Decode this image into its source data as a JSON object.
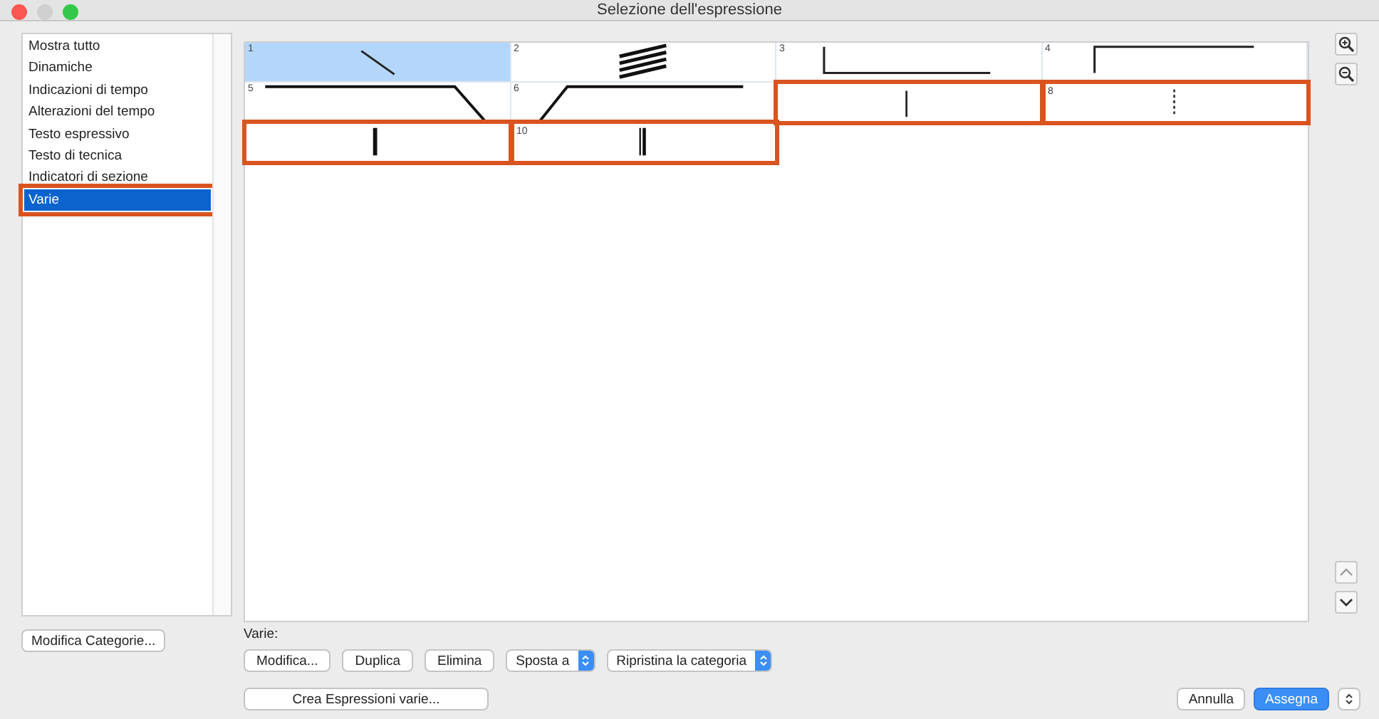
{
  "window": {
    "title": "Selezione dell'espressione"
  },
  "sidebar": {
    "items": [
      {
        "label": "Mostra tutto",
        "selected": false,
        "outlined": false
      },
      {
        "label": "Dinamiche",
        "selected": false,
        "outlined": false
      },
      {
        "label": "Indicazioni di tempo",
        "selected": false,
        "outlined": false
      },
      {
        "label": "Alterazioni del tempo",
        "selected": false,
        "outlined": false
      },
      {
        "label": "Testo espressivo",
        "selected": false,
        "outlined": false
      },
      {
        "label": "Testo di tecnica",
        "selected": false,
        "outlined": false
      },
      {
        "label": "Indicatori di sezione",
        "selected": false,
        "outlined": false
      },
      {
        "label": "Varie",
        "selected": true,
        "outlined": true
      }
    ]
  },
  "edit_categories_button": "Modifica Categorie...",
  "grid": {
    "cells": [
      {
        "number": "1",
        "kind": "slash",
        "selected": true,
        "outlined": false
      },
      {
        "number": "2",
        "kind": "tremolo",
        "selected": false,
        "outlined": false
      },
      {
        "number": "3",
        "kind": "bracket-down",
        "selected": false,
        "outlined": false
      },
      {
        "number": "4",
        "kind": "bracket-up",
        "selected": false,
        "outlined": false
      },
      {
        "number": "5",
        "kind": "line-down",
        "selected": false,
        "outlined": false
      },
      {
        "number": "6",
        "kind": "line-up",
        "selected": false,
        "outlined": false
      },
      {
        "kind": "bar",
        "selected": false,
        "outlined": true
      },
      {
        "number": "8",
        "kind": "dotted-bar",
        "selected": false,
        "outlined": true
      },
      {
        "kind": "thick-bar",
        "selected": false,
        "outlined": true
      },
      {
        "number": "10",
        "kind": "double-bar",
        "selected": false,
        "outlined": true
      }
    ]
  },
  "category_label": "Varie:",
  "actions": [
    {
      "label": "Modifica...",
      "kind": "button"
    },
    {
      "label": "Duplica",
      "kind": "button"
    },
    {
      "label": "Elimina",
      "kind": "button"
    },
    {
      "label": "Sposta a",
      "kind": "popup"
    },
    {
      "label": "Ripristina la categoria",
      "kind": "popup"
    }
  ],
  "create_button": "Crea Espressioni varie...",
  "cancel_button": "Annulla",
  "assign_button": "Assegna"
}
